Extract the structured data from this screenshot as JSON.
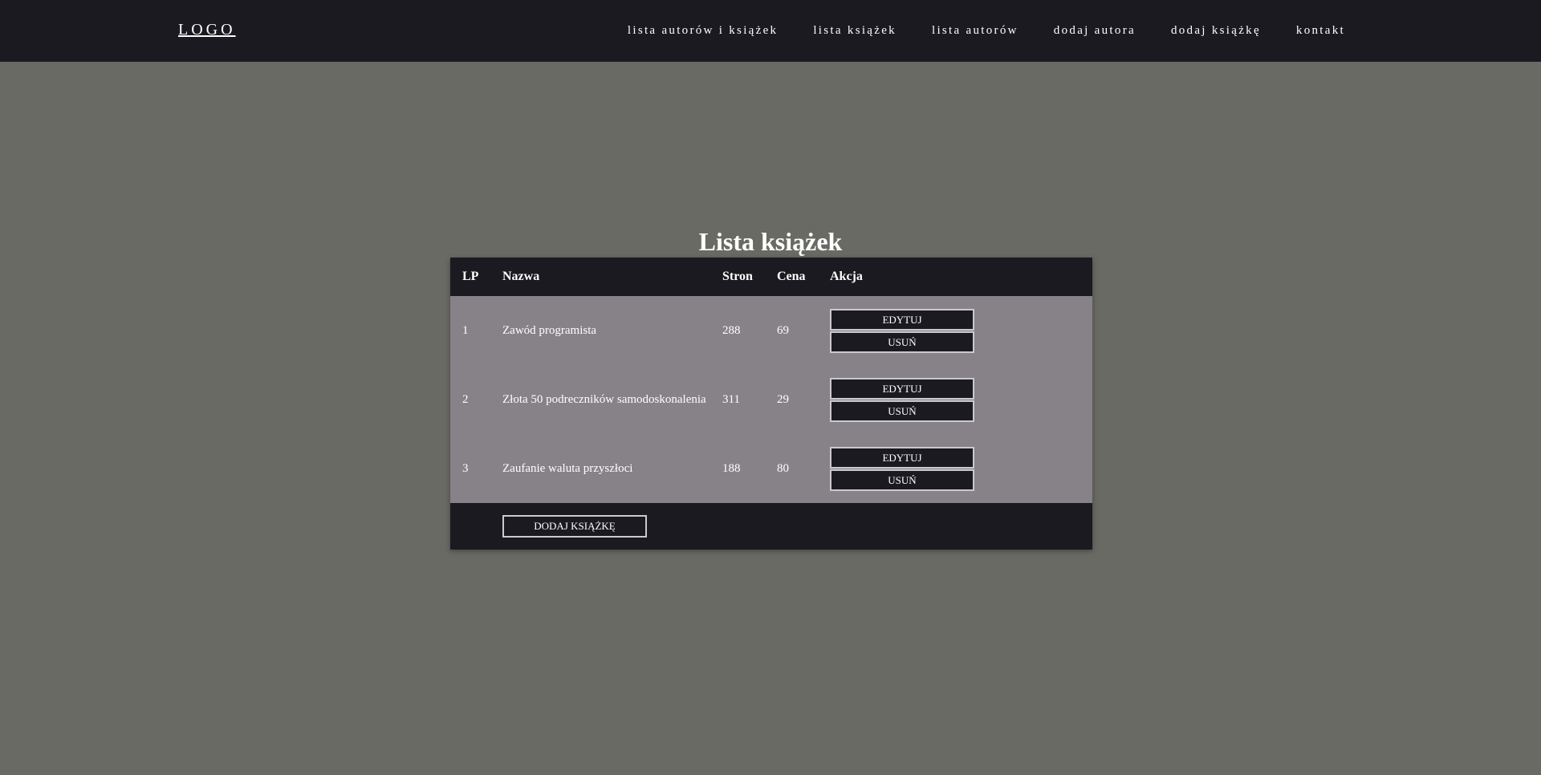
{
  "header": {
    "logo": "LOGO",
    "nav": [
      {
        "label": "lista autorów i książek"
      },
      {
        "label": "lista książek"
      },
      {
        "label": "lista autorów"
      },
      {
        "label": "dodaj autora"
      },
      {
        "label": "dodaj książkę"
      },
      {
        "label": "kontakt"
      }
    ]
  },
  "main": {
    "title": "Lista książek",
    "table": {
      "headers": {
        "lp": "LP",
        "name": "Nazwa",
        "pages": "Stron",
        "price": "Cena",
        "action": "Akcja"
      },
      "rows": [
        {
          "lp": "1",
          "name": "Zawód programista",
          "pages": "288",
          "price": "69",
          "edit": "EDYTUJ",
          "delete": "USUŃ"
        },
        {
          "lp": "2",
          "name": "Złota 50 podreczników samodoskonalenia",
          "pages": "311",
          "price": "29",
          "edit": "EDYTUJ",
          "delete": "USUŃ"
        },
        {
          "lp": "3",
          "name": "Zaufanie waluta przyszłoci",
          "pages": "188",
          "price": "80",
          "edit": "EDYTUJ",
          "delete": "USUŃ"
        }
      ]
    },
    "add_button": "DODAJ KSIĄŻKĘ"
  },
  "colors": {
    "background": "#696a64",
    "dark": "#1a1a20",
    "row": "#878188",
    "text": "#ffffff"
  }
}
